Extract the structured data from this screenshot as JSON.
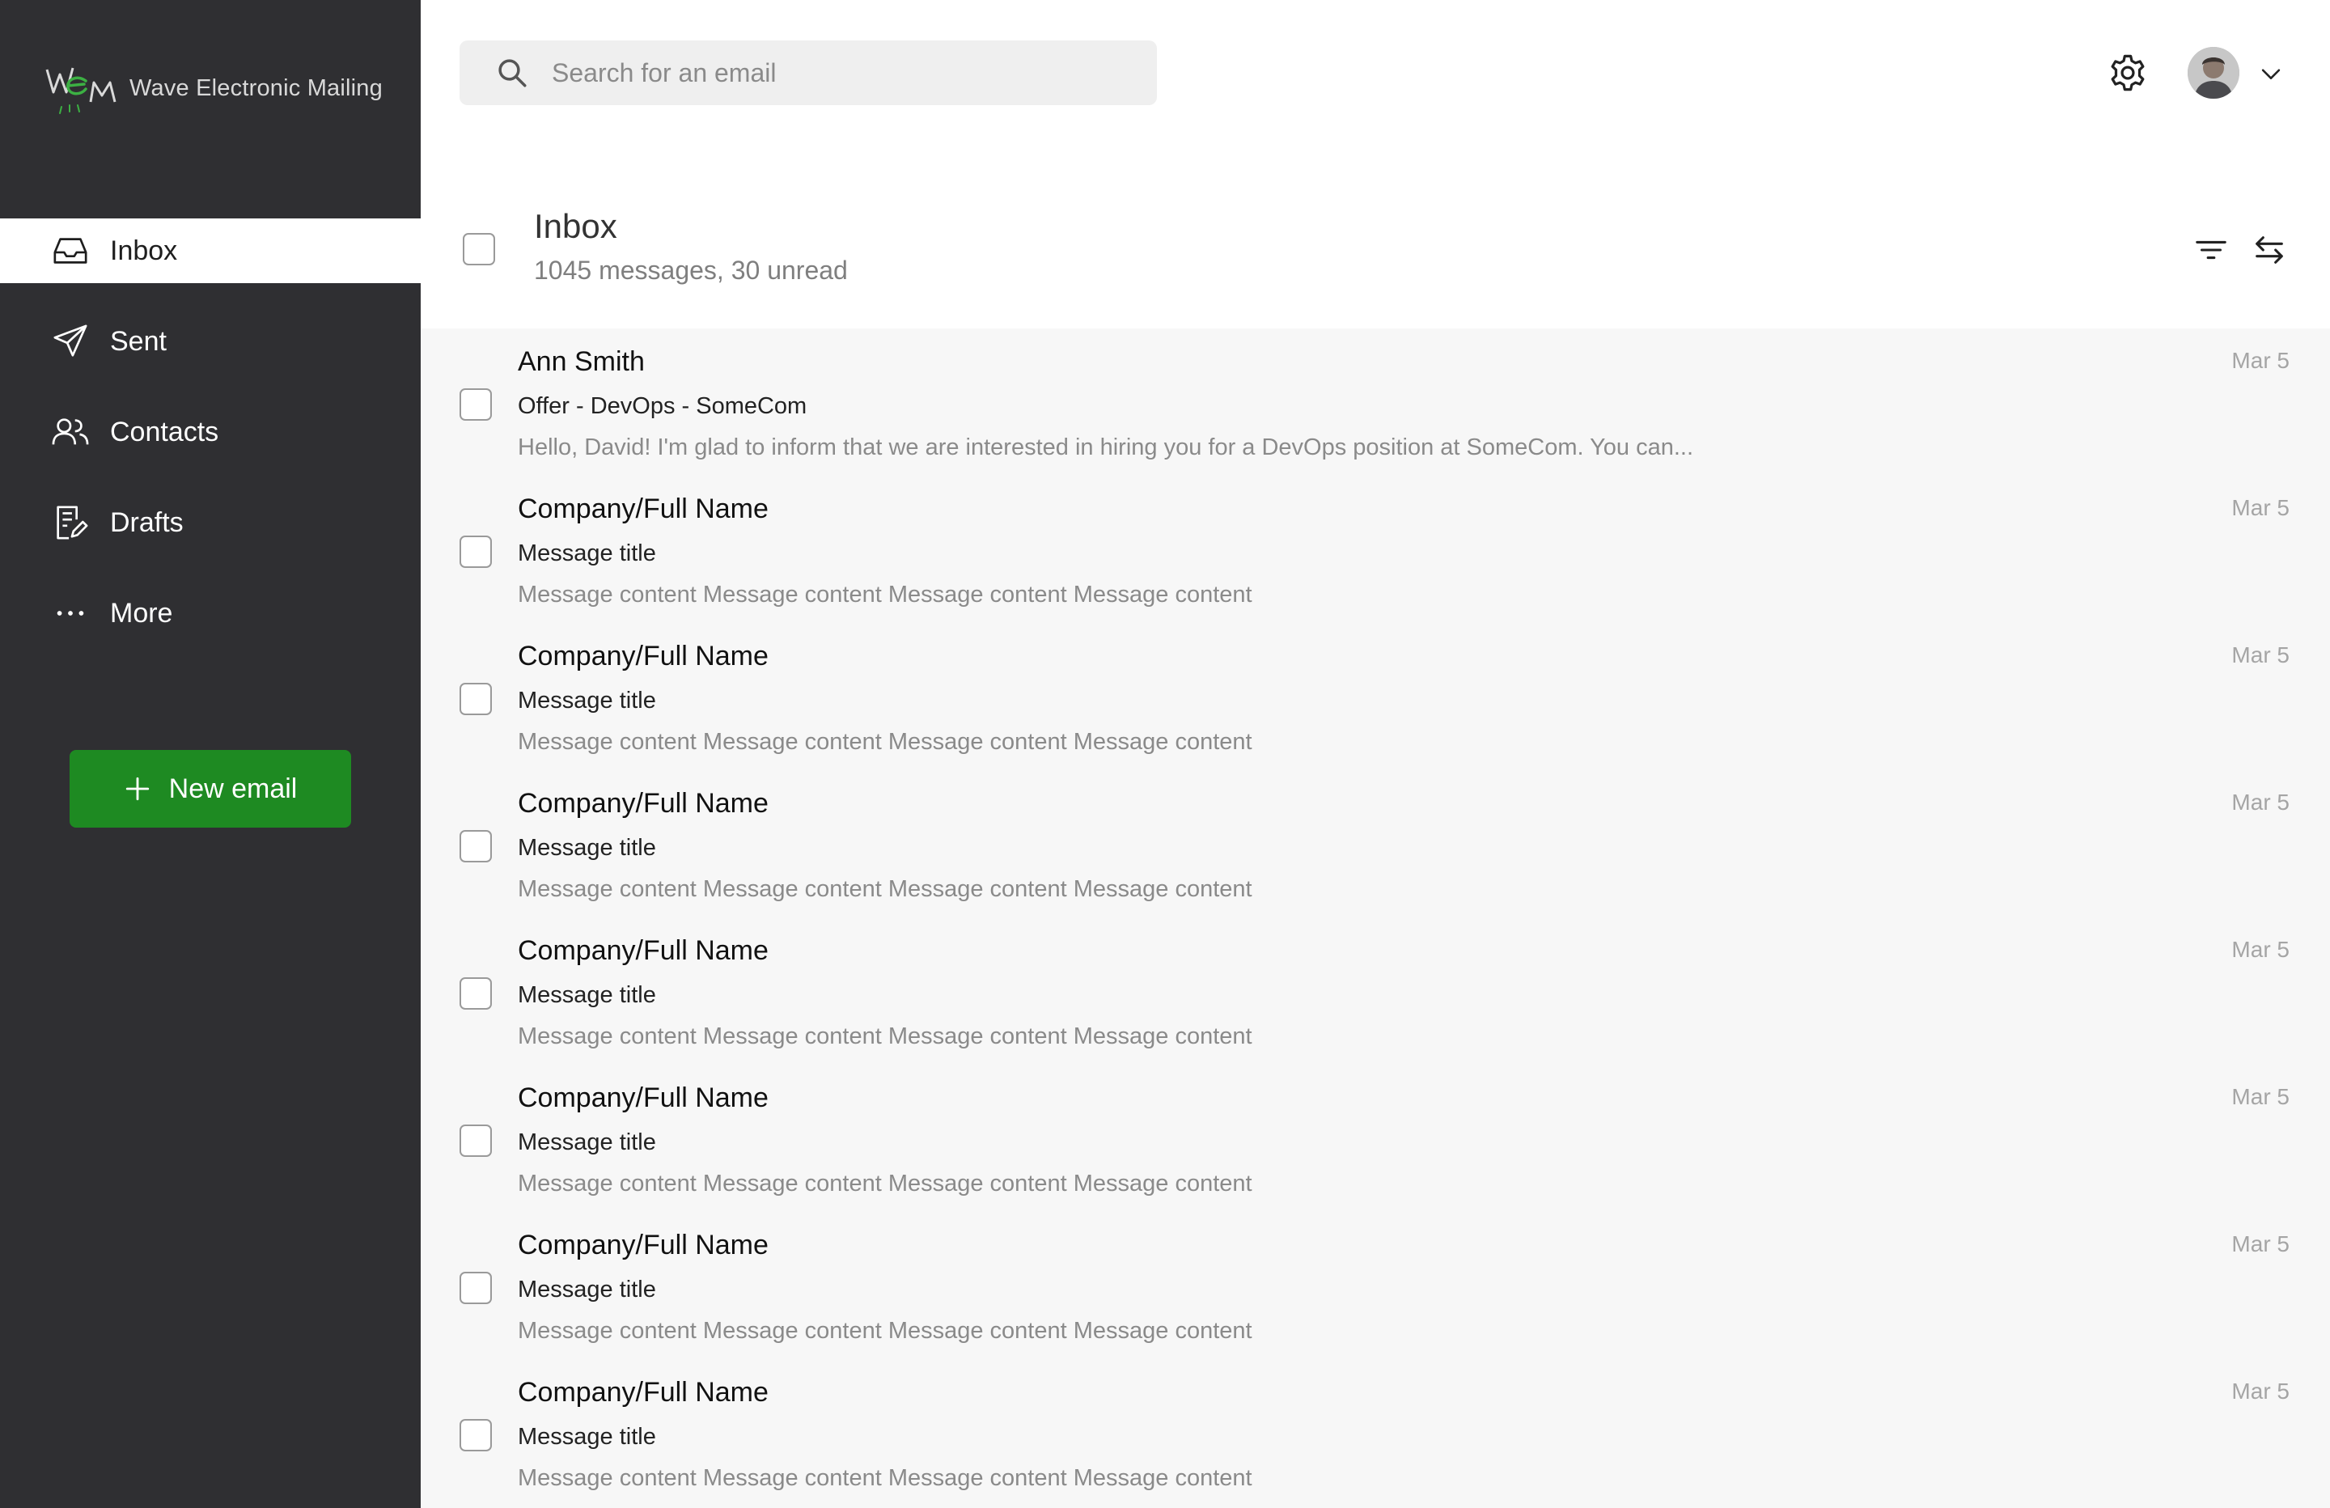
{
  "app": {
    "logo_text": "Wave Electronic Mailing",
    "colors": {
      "sidebar": "#2f2f32",
      "accent": "#1e8a22",
      "list_bg": "#f7f7f7"
    }
  },
  "sidebar": {
    "items": [
      {
        "label": "Inbox",
        "icon": "inbox-icon",
        "active": true
      },
      {
        "label": "Sent",
        "icon": "send-icon",
        "active": false
      },
      {
        "label": "Contacts",
        "icon": "contacts-icon",
        "active": false
      },
      {
        "label": "Drafts",
        "icon": "drafts-icon",
        "active": false
      },
      {
        "label": "More",
        "icon": "more-icon",
        "active": false
      }
    ],
    "new_email_label": "New email"
  },
  "topbar": {
    "search_placeholder": "Search for an email",
    "settings_icon": "gear-icon",
    "avatar": "user-avatar",
    "menu_icon": "chevron-down-icon"
  },
  "inbox": {
    "title": "Inbox",
    "subtitle": "1045 messages, 30 unread"
  },
  "messages": [
    {
      "sender": "Ann Smith",
      "subject": "Offer - DevOps - SomeCom",
      "preview": "Hello, David! I'm glad to inform that we are interested in hiring you for a DevOps position at SomeCom. You can...",
      "date": "Mar 5"
    },
    {
      "sender": "Company/Full Name",
      "subject": "Message title",
      "preview": "Message content Message content Message content Message content",
      "date": "Mar 5"
    },
    {
      "sender": "Company/Full Name",
      "subject": "Message title",
      "preview": "Message content Message content Message content Message content",
      "date": "Mar 5"
    },
    {
      "sender": "Company/Full Name",
      "subject": "Message title",
      "preview": "Message content Message content Message content Message content",
      "date": "Mar 5"
    },
    {
      "sender": "Company/Full Name",
      "subject": "Message title",
      "preview": "Message content Message content Message content Message content",
      "date": "Mar 5"
    },
    {
      "sender": "Company/Full Name",
      "subject": "Message title",
      "preview": "Message content Message content Message content Message content",
      "date": "Mar 5"
    },
    {
      "sender": "Company/Full Name",
      "subject": "Message title",
      "preview": "Message content Message content Message content Message content",
      "date": "Mar 5"
    },
    {
      "sender": "Company/Full Name",
      "subject": "Message title",
      "preview": "Message content Message content Message content Message content",
      "date": "Mar 5"
    }
  ]
}
